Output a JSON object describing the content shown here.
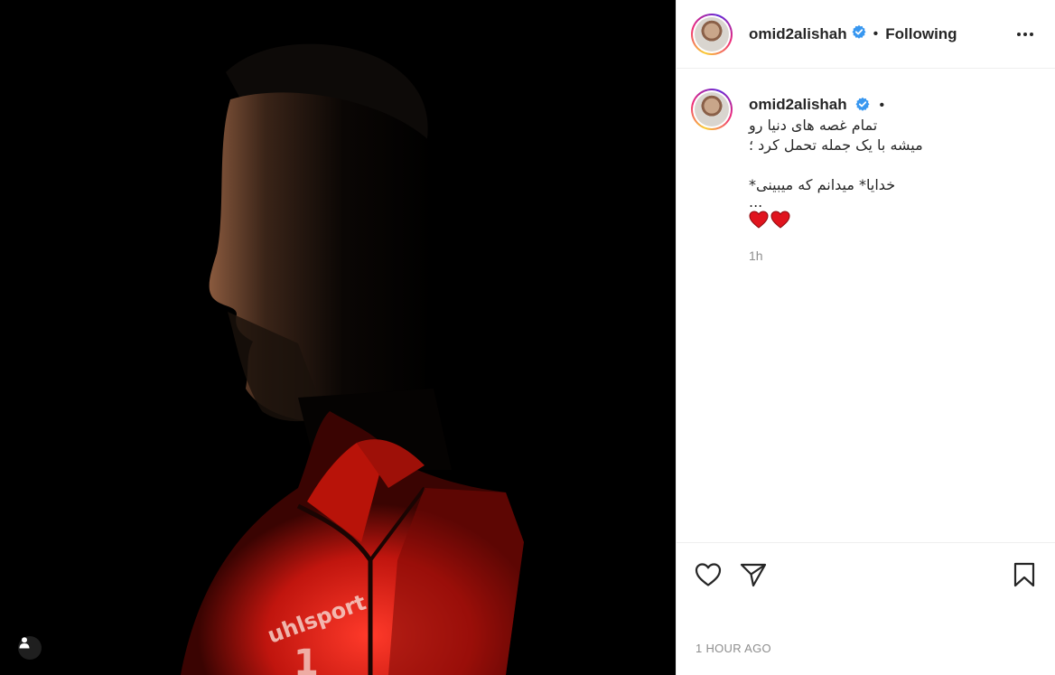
{
  "post": {
    "username": "omid2alishah",
    "follow_status": "Following",
    "separator": "•",
    "caption_lines": [
      "تمام غصه های دنیا رو",
      "میشه با یک جمله تحمل کرد ؛",
      "خدایا* میدانم که میبینی*",
      "..."
    ],
    "hearts": "❤❤",
    "relative_time": "1h",
    "posted_time": "1 HOUR AGO",
    "jersey_text": "uhlsport",
    "jersey_number": "1"
  },
  "icons": {
    "verified": "verified-badge-icon",
    "more": "more-options-icon",
    "like": "heart-outline-icon",
    "share": "paper-plane-icon",
    "save": "bookmark-outline-icon",
    "user_tag": "user-tag-icon"
  },
  "colors": {
    "verified_blue": "#3897f0",
    "jersey_red": "#e0261a",
    "heart_red": "#e0141e",
    "text": "#262626",
    "muted": "#8e8e8e"
  }
}
